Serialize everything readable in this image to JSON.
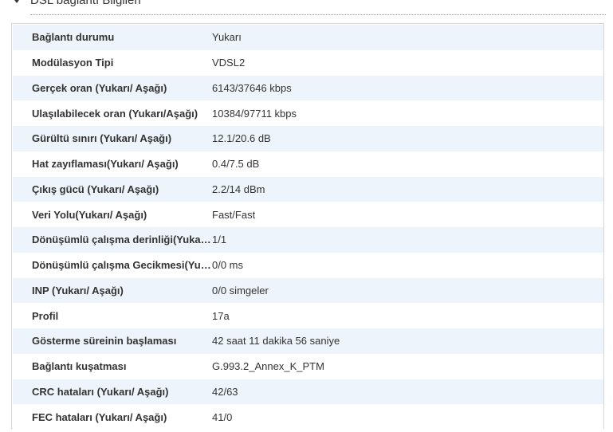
{
  "section": {
    "title": "DSL bağlantı Bilgileri"
  },
  "rows": [
    {
      "label": "Bağlantı durumu",
      "value": "Yukarı"
    },
    {
      "label": "Modülasyon Tipi",
      "value": "VDSL2"
    },
    {
      "label": "Gerçek oran (Yukarı/ Aşağı)",
      "value": "6143/37646 kbps"
    },
    {
      "label": "Ulaşılabilecek oran (Yukarı/Aşağı)",
      "value": "10384/97711 kbps"
    },
    {
      "label": "Gürültü sınırı (Yukarı/ Aşağı)",
      "value": "12.1/20.6 dB"
    },
    {
      "label": "Hat zayıflaması(Yukarı/ Aşağı)",
      "value": "0.4/7.5 dB"
    },
    {
      "label": "Çıkış gücü (Yukarı/ Aşağı)",
      "value": "2.2/14 dBm"
    },
    {
      "label": "Veri Yolu(Yukarı/ Aşağı)",
      "value": "Fast/Fast"
    },
    {
      "label": "Dönüşümlü çalışma derinliği(Yukarı/ Aşağı)",
      "value": "1/1"
    },
    {
      "label": "Dönüşümlü çalışma Gecikmesi(Yukarı/ Aşağı)",
      "value": "0/0 ms"
    },
    {
      "label": "INP (Yukarı/ Aşağı)",
      "value": "0/0 simgeler"
    },
    {
      "label": "Profil",
      "value": "17a"
    },
    {
      "label": "Gösterme süreinin başlaması",
      "value": "42 saat 11 dakika 56 saniye"
    },
    {
      "label": "Bağlantı kuşatması",
      "value": "G.993.2_Annex_K_PTM"
    },
    {
      "label": "CRC hataları (Yukarı/ Aşağı)",
      "value": "42/63"
    },
    {
      "label": "FEC hataları (Yukarı/ Aşağı)",
      "value": "41/0"
    }
  ]
}
